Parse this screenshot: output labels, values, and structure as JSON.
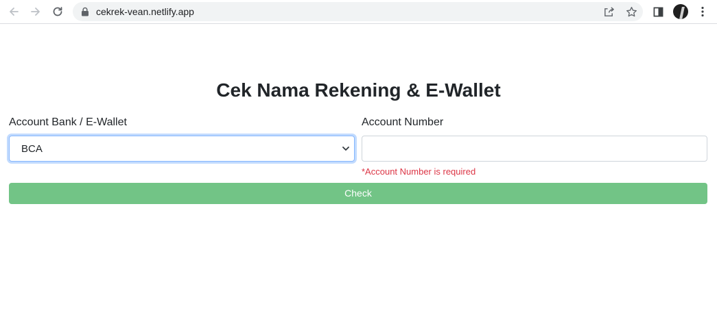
{
  "browser": {
    "url": "cekrek-vean.netlify.app",
    "icons": [
      "back-arrow-icon",
      "forward-arrow-icon",
      "reload-icon",
      "lock-icon",
      "share-icon",
      "star-icon",
      "side-panel-icon",
      "avatar",
      "more-icon"
    ]
  },
  "page": {
    "title": "Cek Nama Rekening & E-Wallet",
    "bank_label": "Account Bank / E-Wallet",
    "bank_selected": "BCA",
    "account_label": "Account Number",
    "account_value": "",
    "account_error": "*Account Number is required",
    "check_button": "Check"
  },
  "colors": {
    "button": "#72c486",
    "error": "#dc3545",
    "focus_border": "#86b7fe"
  }
}
